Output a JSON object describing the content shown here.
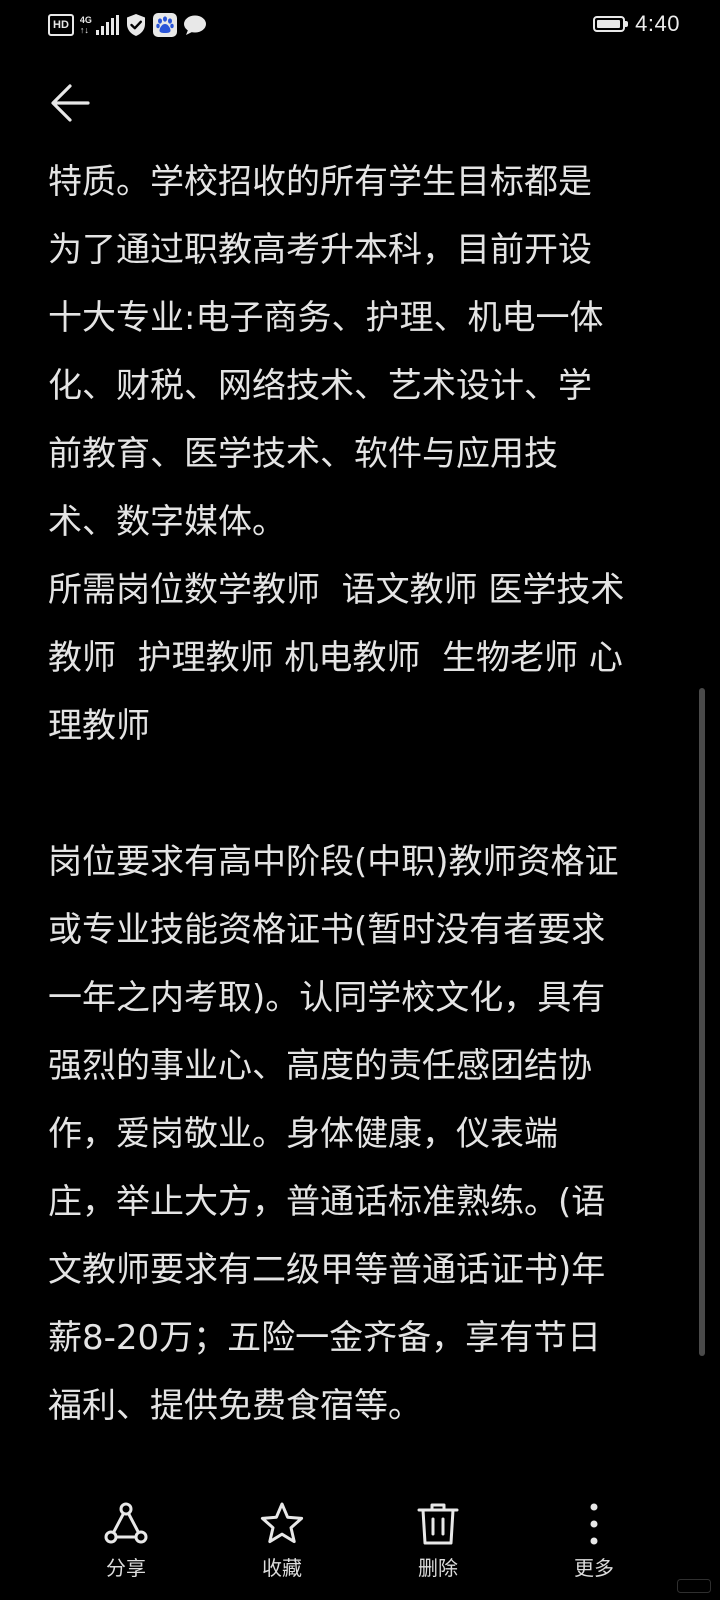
{
  "status_bar": {
    "hd": "HD",
    "net_top": "4G",
    "net_bottom": "↑↓",
    "time": "4:40",
    "battery_level": 0.95,
    "icons": [
      "hd-icon",
      "4g-signal-icon",
      "shield-check-icon",
      "baidu-paw-icon",
      "chat-bubble-icon",
      "battery-icon"
    ]
  },
  "nav": {
    "back_icon": "arrow-left-icon"
  },
  "article": {
    "lines": [
      "特质。学校招收的所有学生目标都是",
      "为了通过职教高考升本科，目前开设",
      "十大专业:电子商务、护理、机电一体",
      "化、财税、网络技术、艺术设计、学",
      "前教育、医学技术、软件与应用技",
      "术、数字媒体。",
      "所需岗位数学教师  语文教师 医学技术",
      "教师  护理教师 机电教师  生物老师 心",
      "理教师",
      "",
      "岗位要求有高中阶段(中职)教师资格证",
      "或专业技能资格证书(暂时没有者要求",
      "一年之内考取)。认同学校文化，具有",
      "强烈的事业心、高度的责任感团结协",
      "作，爱岗敬业。身体健康，仪表端",
      "庄，举止大方，普通话标准熟练。(语",
      "文教师要求有二级甲等普通话证书)年",
      "薪8-20万；五险一金齐备，享有节日",
      "福利、提供免费食宿等。"
    ]
  },
  "toolbar": {
    "share_label": "分享",
    "favorite_label": "收藏",
    "delete_label": "删除",
    "more_label": "更多",
    "icons": [
      "share-icon",
      "star-icon",
      "trash-icon",
      "more-vertical-icon"
    ]
  },
  "colors": {
    "background": "#000000",
    "text": "#e4e4e4",
    "icon": "#e8e8e8",
    "scrollbar": "#4a4a4a"
  }
}
